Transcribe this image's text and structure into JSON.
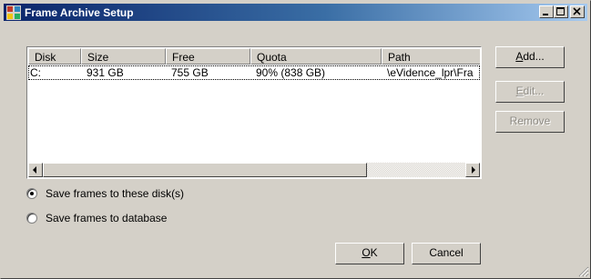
{
  "window": {
    "title": "Frame Archive Setup",
    "titlebar_gradient": [
      "#0a246a",
      "#a6caf0"
    ]
  },
  "listview": {
    "columns": [
      "Disk",
      "Size",
      "Free",
      "Quota",
      "Path"
    ],
    "rows": [
      {
        "disk": "C:",
        "size": "931 GB",
        "free": "755 GB",
        "quota": "90%  (838 GB)",
        "path": "\\eVidence_lpr\\Fra"
      }
    ]
  },
  "buttons": {
    "add": {
      "label": "Add...",
      "mnemonic": "A",
      "rest": "dd...",
      "enabled": true
    },
    "edit": {
      "label": "Edit...",
      "mnemonic": "E",
      "rest": "dit...",
      "enabled": false
    },
    "remove": {
      "label": "Remove",
      "enabled": false
    },
    "ok": {
      "label": "OK",
      "mnemonic": "O",
      "rest": "K"
    },
    "cancel": {
      "label": "Cancel"
    }
  },
  "options": [
    {
      "label": "Save frames to these disk(s)",
      "selected": true
    },
    {
      "label": "Save frames to database",
      "selected": false
    }
  ]
}
